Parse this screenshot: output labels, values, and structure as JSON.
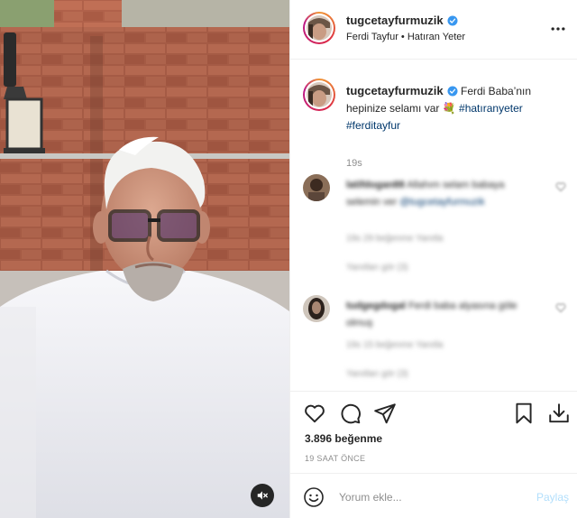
{
  "post": {
    "username": "tugcetayfurmuzik",
    "verified": true,
    "subtitle": "Ferdi Tayfur • Hatıran Yeter",
    "more_icon": "more-horizontal-icon",
    "media": {
      "mute_icon": "speaker-muted-icon"
    },
    "caption": {
      "text": "Ferdi Baba’nın hepinize selamı var",
      "emoji": "💐",
      "hashtags": [
        "#hatıranyeter",
        "#ferditayfur"
      ],
      "time": "19s"
    },
    "comments": [
      {
        "username": "latifdogan88",
        "text": "Allahım selam babaya selemin ver",
        "mention": "@tugcetayfurmuzik",
        "meta": "19s   29 beğenme   Yanıtla",
        "replies": "Yanıtları gör (3)"
      },
      {
        "username": "tudgegdogal",
        "text": "Ferdi baba alyasına göle olmuş",
        "meta": "19s   15 beğenme   Yanıtla",
        "replies": "Yanıtları gör (3)"
      }
    ],
    "actions": {
      "like_icon": "heart-icon",
      "comment_icon": "comment-bubble-icon",
      "share_icon": "paper-plane-icon",
      "save_icon": "bookmark-icon",
      "download_icon": "download-icon"
    },
    "likes": "3.896 beğenme",
    "time_ago": "19 SAAT ÖNCE",
    "comment_box": {
      "placeholder": "Yorum ekle...",
      "post_label": "Paylaş",
      "emoji_icon": "smiley-icon"
    }
  },
  "colors": {
    "link": "#00376b",
    "muted": "#8e8e8e",
    "verified": "#3897f0",
    "post_button": "#b2dffc"
  }
}
